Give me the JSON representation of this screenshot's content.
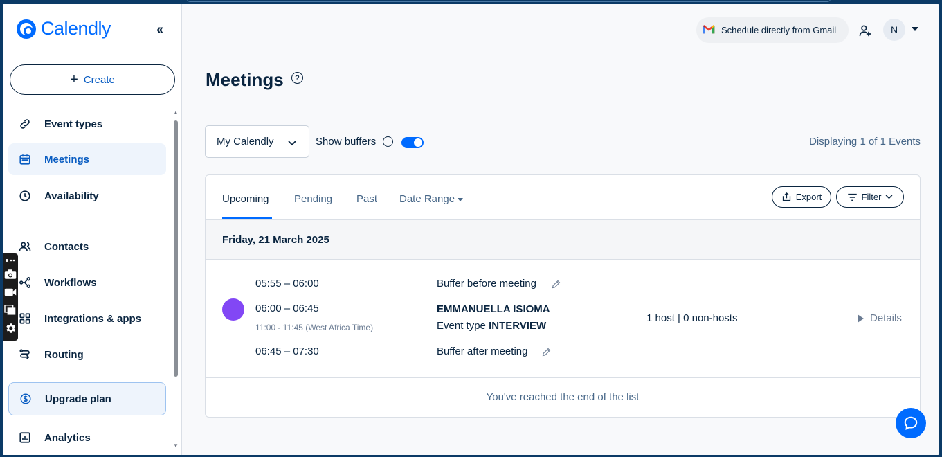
{
  "brand": {
    "name": "Calendly",
    "accent": "#006bff"
  },
  "sidebar": {
    "collapse_icon": "double-chevron-left-icon",
    "create_label": "Create",
    "items": [
      {
        "label": "Event types",
        "icon": "link-icon"
      },
      {
        "label": "Meetings",
        "icon": "calendar-icon",
        "active": true
      },
      {
        "label": "Availability",
        "icon": "clock-icon"
      },
      {
        "label": "Contacts",
        "icon": "people-icon"
      },
      {
        "label": "Workflows",
        "icon": "workflow-icon"
      },
      {
        "label": "Integrations & apps",
        "icon": "grid-icon"
      },
      {
        "label": "Routing",
        "icon": "routing-icon"
      },
      {
        "label": "Upgrade plan",
        "icon": "dollar-icon"
      },
      {
        "label": "Analytics",
        "icon": "analytics-icon"
      }
    ]
  },
  "header": {
    "gmail_label": "Schedule directly from Gmail",
    "avatar_initial": "N"
  },
  "page": {
    "title": "Meetings",
    "calendar_select": "My Calendly",
    "show_buffers_label": "Show buffers",
    "show_buffers_on": true,
    "displaying": "Displaying 1 of 1 Events"
  },
  "tabs": {
    "upcoming": "Upcoming",
    "pending": "Pending",
    "past": "Past",
    "date_range": "Date Range",
    "export": "Export",
    "filter": "Filter"
  },
  "list": {
    "date_heading": "Friday, 21 March 2025",
    "event": {
      "buffer_before_time": "05:55 – 06:00",
      "buffer_before_label": "Buffer before meeting",
      "time": "06:00 – 06:45",
      "local_time": "11:00 - 11:45 (West Africa Time)",
      "invitee": "EMMANUELLA ISIOMA",
      "event_type_prefix": "Event type",
      "event_type": "INTERVIEW",
      "hosts": "1 host | 0 non-hosts",
      "buffer_after_time": "06:45 – 07:30",
      "buffer_after_label": "Buffer after meeting",
      "details": "Details",
      "color": "#8247f5"
    },
    "end_text": "You've reached the end of the list"
  }
}
